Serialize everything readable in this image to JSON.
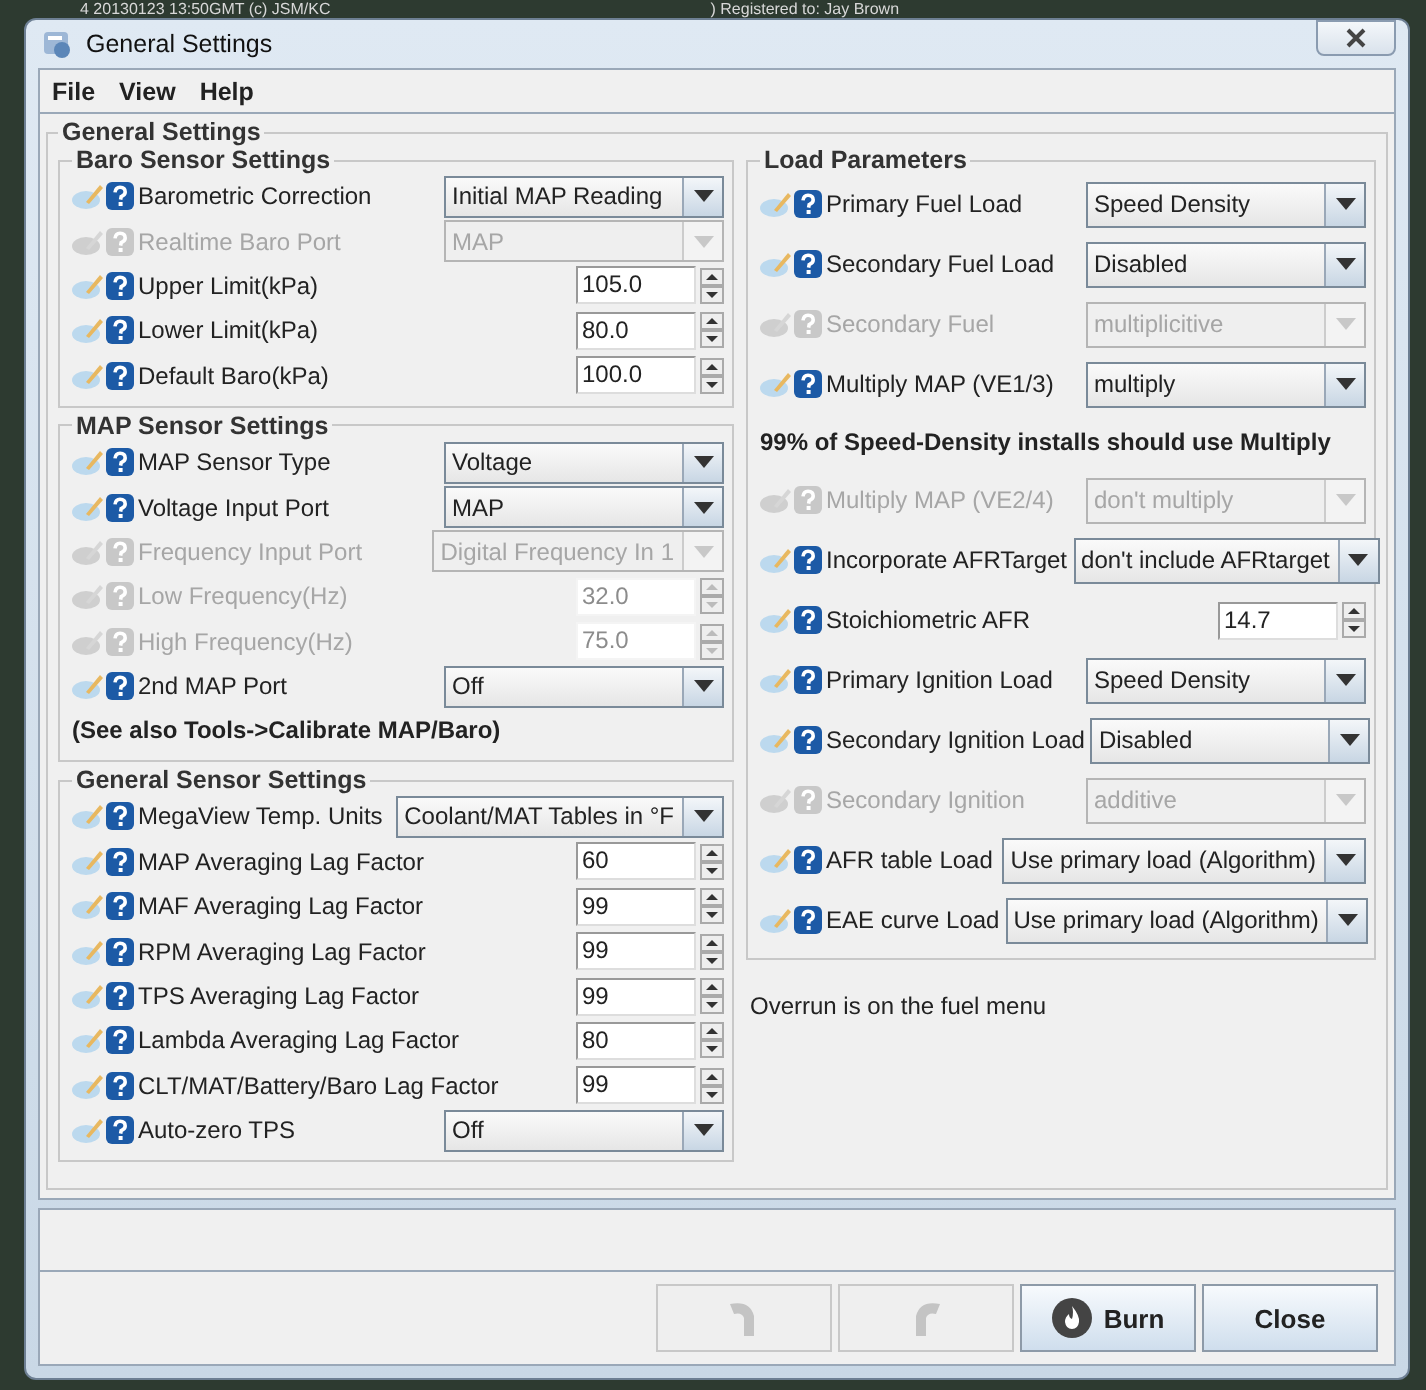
{
  "background_window": {
    "title_left": "4 20130123 13:50GMT (c) JSM/KC",
    "title_right": ") Registered to: Jay Brown"
  },
  "window": {
    "title": "General Settings"
  },
  "menu": [
    {
      "label": "File"
    },
    {
      "label": "View"
    },
    {
      "label": "Help"
    }
  ],
  "panel": {
    "title": "General Settings",
    "left_sections": [
      {
        "title": "Baro Sensor Settings",
        "rows": [
          {
            "kind": "select",
            "label": "Barometric Correction",
            "value": "Initial MAP Reading",
            "disabled": false
          },
          {
            "kind": "select",
            "label": "Realtime Baro Port",
            "value": "MAP",
            "disabled": true
          },
          {
            "kind": "spinner",
            "label": "Upper Limit(kPa)",
            "value": "105.0",
            "disabled": false
          },
          {
            "kind": "spinner",
            "label": "Lower Limit(kPa)",
            "value": "80.0",
            "disabled": false
          },
          {
            "kind": "spinner",
            "label": "Default Baro(kPa)",
            "value": "100.0",
            "disabled": false
          }
        ]
      },
      {
        "title": "MAP Sensor Settings",
        "rows": [
          {
            "kind": "select",
            "label": "MAP Sensor Type",
            "value": "Voltage",
            "disabled": false
          },
          {
            "kind": "select",
            "label": "Voltage Input Port",
            "value": "MAP",
            "disabled": false
          },
          {
            "kind": "select",
            "label": "Frequency Input Port",
            "value": "Digital Frequency In 1",
            "disabled": true
          },
          {
            "kind": "spinner",
            "label": "Low Frequency(Hz)",
            "value": "32.0",
            "disabled": true
          },
          {
            "kind": "spinner",
            "label": "High Frequency(Hz)",
            "value": "75.0",
            "disabled": true
          },
          {
            "kind": "select",
            "label": "2nd MAP Port",
            "value": "Off",
            "disabled": false
          },
          {
            "kind": "note",
            "text": "(See also Tools->Calibrate MAP/Baro)"
          }
        ]
      },
      {
        "title": "General Sensor Settings",
        "rows": [
          {
            "kind": "select",
            "label": "MegaView Temp. Units",
            "value": "Coolant/MAT Tables in °F",
            "disabled": false
          },
          {
            "kind": "spinner",
            "label": "MAP Averaging Lag Factor",
            "value": "60",
            "disabled": false
          },
          {
            "kind": "spinner",
            "label": "MAF Averaging Lag Factor",
            "value": "99",
            "disabled": false
          },
          {
            "kind": "spinner",
            "label": "RPM Averaging Lag Factor",
            "value": "99",
            "disabled": false
          },
          {
            "kind": "spinner",
            "label": "TPS Averaging Lag Factor",
            "value": "99",
            "disabled": false
          },
          {
            "kind": "spinner",
            "label": "Lambda Averaging Lag Factor",
            "value": "80",
            "disabled": false
          },
          {
            "kind": "spinner",
            "label": "CLT/MAT/Battery/Baro Lag Factor",
            "value": "99",
            "disabled": false
          },
          {
            "kind": "select",
            "label": "Auto-zero TPS",
            "value": "Off",
            "disabled": false
          }
        ]
      }
    ],
    "right_section": {
      "title": "Load Parameters",
      "rows": [
        {
          "kind": "select",
          "label": "Primary Fuel Load",
          "value": "Speed Density",
          "disabled": false
        },
        {
          "kind": "select",
          "label": "Secondary Fuel Load",
          "value": "Disabled",
          "disabled": false
        },
        {
          "kind": "select",
          "label": "Secondary Fuel",
          "value": "multiplicitive",
          "disabled": true
        },
        {
          "kind": "select",
          "label": "Multiply MAP (VE1/3)",
          "value": "multiply",
          "disabled": false
        },
        {
          "kind": "note",
          "text": "99% of Speed-Density installs should use Multiply"
        },
        {
          "kind": "select",
          "label": "Multiply MAP (VE2/4)",
          "value": "don't multiply",
          "disabled": true
        },
        {
          "kind": "select",
          "label": "Incorporate AFRTarget",
          "value": "don't include AFRtarget",
          "disabled": false
        },
        {
          "kind": "spinner",
          "label": "Stoichiometric AFR",
          "value": "14.7",
          "disabled": false
        },
        {
          "kind": "select",
          "label": "Primary Ignition Load",
          "value": "Speed Density",
          "disabled": false
        },
        {
          "kind": "select",
          "label": "Secondary Ignition Load",
          "value": "Disabled",
          "disabled": false
        },
        {
          "kind": "select",
          "label": "Secondary Ignition",
          "value": "additive",
          "disabled": true
        },
        {
          "kind": "select",
          "label": "AFR table Load",
          "value": "Use primary load (Algorithm)",
          "disabled": false
        },
        {
          "kind": "select",
          "label": "EAE curve Load",
          "value": "Use primary load (Algorithm)",
          "disabled": false
        }
      ]
    },
    "footer_note": "Overrun is on the fuel menu"
  },
  "buttons": [
    {
      "kind": "undo",
      "disabled": true
    },
    {
      "kind": "redo",
      "disabled": true
    },
    {
      "kind": "burn",
      "label": "Burn",
      "disabled": false
    },
    {
      "kind": "text",
      "label": "Close",
      "disabled": false
    }
  ]
}
